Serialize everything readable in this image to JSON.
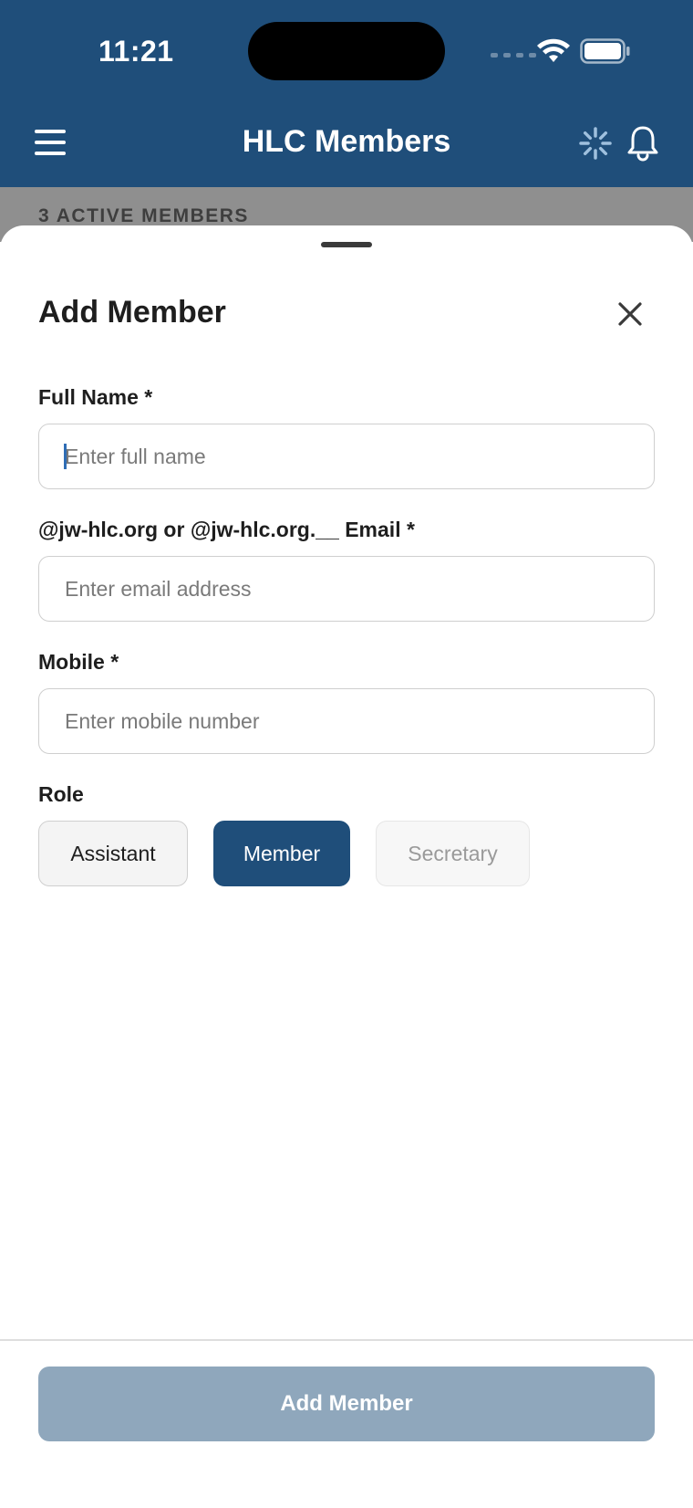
{
  "status_bar": {
    "time": "11:21"
  },
  "header": {
    "title": "HLC Members"
  },
  "backdrop": {
    "count_text": "3 ACTIVE MEMBERS"
  },
  "sheet": {
    "title": "Add Member",
    "fields": [
      {
        "label": "Full Name *",
        "placeholder": "Enter full name",
        "value": ""
      },
      {
        "label": "@jw-hlc.org or @jw-hlc.org.__ Email *",
        "placeholder": "Enter email address",
        "value": ""
      },
      {
        "label": "Mobile *",
        "placeholder": "Enter mobile number",
        "value": ""
      }
    ],
    "role": {
      "label": "Role",
      "options": [
        "Assistant",
        "Member",
        "Secretary"
      ],
      "selected": "Member"
    },
    "submit_label": "Add Member"
  },
  "colors": {
    "header_bg": "#1f4e7a",
    "selected_role_bg": "#1f4e7a",
    "submit_disabled_bg": "#8fa7bc",
    "backdrop": "#8f8f8f"
  },
  "icons": [
    "menu-icon",
    "spinner-icon",
    "bell-icon",
    "close-icon",
    "wifi-icon",
    "battery-icon"
  ]
}
